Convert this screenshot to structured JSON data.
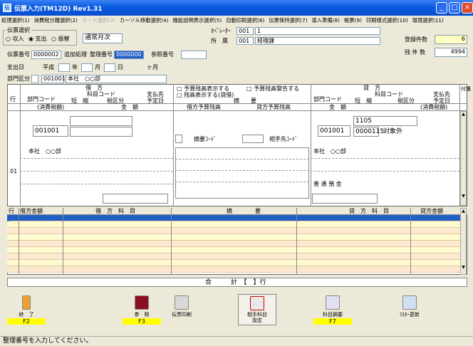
{
  "window": {
    "title": "伝票入力(TM12D) Rev1.31",
    "minimize": "_",
    "maximize": "□",
    "close": "×"
  },
  "menu": [
    {
      "label": "処理選択(1)",
      "disabled": false
    },
    {
      "label": "消費税分離選択(2)",
      "disabled": false
    },
    {
      "label": "モード選択(3)",
      "disabled": true
    },
    {
      "label": "カーソル移動選択(4)",
      "disabled": false
    },
    {
      "label": "機能説明表示選択(5)",
      "disabled": false
    },
    {
      "label": "自動印刷選択(6)",
      "disabled": false
    },
    {
      "label": "伝票保持選択(7)",
      "disabled": false
    },
    {
      "label": "導入準備(8)",
      "disabled": false
    },
    {
      "label": "帳票(9)",
      "disabled": false
    },
    {
      "label": "印刷様式選択(10)",
      "disabled": false
    },
    {
      "label": "環境選択(11)",
      "disabled": false
    }
  ],
  "header": {
    "slip_select_label": "伝票選択",
    "radio_receipt": "収入",
    "radio_payment": "支出",
    "radio_transfer": "振替",
    "mode_value": "通常月次",
    "operator_label": "ｵﾍﾟﾚｰﾀｰ",
    "operator_value": "001",
    "operator_value2": "1",
    "dept_label": "所　属",
    "dept_code": "001",
    "dept_name": "経理課",
    "count_label": "登録件数",
    "count_value": "6",
    "remain_label": "残 件 数",
    "remain_value": "4994",
    "slip_no_label": "伝票番号",
    "slip_no_value": "0000002",
    "add_label": "追加処理",
    "ref_no_label": "整理番号",
    "ref_no_value": "0000000",
    "ref_label": "参照番号",
    "date_label": "支出日",
    "era": "平成",
    "year": "年",
    "month": "月",
    "day": "日",
    "months_suffix": "ヶ月",
    "section_label": "部門区分",
    "section_code": "001001",
    "section_name": "本社　○○部"
  },
  "debit": {
    "title": "借　方",
    "col_row": "行",
    "col_dept": "部門コード",
    "col_subject": "科目コード",
    "col_short": "短　縮",
    "col_tax": "税区分",
    "col_pay": "支払先",
    "col_due": "予定日",
    "col_tax_amt": "(消費税額)",
    "col_amount": "金　額",
    "dept_value": "001001",
    "dept_name": "本社　○○部"
  },
  "middle": {
    "chk_budget_show": "予算残高表示する",
    "chk_budget_warn": "予算残高警告する",
    "chk_balance_show": "残高表示する(貸借)",
    "col_summary": "摘　　要",
    "col_debit_budget": "借方予算残高",
    "col_credit_budget": "貸方予算残高",
    "summary_code": "摘要ｺｰﾄﾞ",
    "partner_code": "相手先ｺｰﾄﾞ"
  },
  "credit": {
    "title": "貸　方",
    "col_dept": "部門コード",
    "col_subject": "科目コード",
    "col_short": "短　縮",
    "col_tax": "税区分",
    "col_pay": "支払先",
    "col_due": "予定日",
    "col_amount": "金　額",
    "col_tax_amt": "(消費税額)",
    "dept_value": "001001",
    "subject_value": "1105",
    "sub_value": "0000115",
    "tax_label": "対象外",
    "dept_name": "本社　○○部",
    "account_name": "普 通 預 金",
    "attach": "付箋"
  },
  "row_no": "01",
  "grid": {
    "col_row": "行",
    "col_debit_amt": "借方金額",
    "col_debit_subj": "借　方　科　目",
    "col_summary": "摘　　　　要",
    "col_credit_subj": "貸　方　科　目",
    "col_credit_amt": "貸方金額",
    "total_label": "合　　　計　【　】行"
  },
  "buttons": [
    {
      "label": "終　了",
      "key": "F2"
    },
    {
      "label": "参　照",
      "key": "F3"
    },
    {
      "label": "伝票印刷",
      "key": ""
    },
    {
      "label": "相手科目\n設定",
      "key": ""
    },
    {
      "label": "科目摘要",
      "key": "F7"
    },
    {
      "label": "ﾏｽﾀｰ更新",
      "key": ""
    }
  ],
  "status": "整理番号を入力してください。"
}
